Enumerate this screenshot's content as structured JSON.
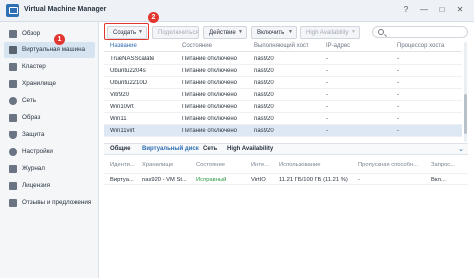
{
  "window": {
    "title": "Virtual Machine Manager",
    "buttons": [
      "?",
      "—",
      "□",
      "✕"
    ]
  },
  "sidebar": {
    "items": [
      {
        "label": "Обзор",
        "icon": "overview-icon",
        "color": "#5a6470"
      },
      {
        "label": "Виртуальная машина",
        "icon": "vm-icon",
        "color": "#5a6470",
        "active": true
      },
      {
        "label": "Кластер",
        "icon": "cluster-icon",
        "color": "#5a6470"
      },
      {
        "label": "Хранилище",
        "icon": "storage-icon",
        "color": "#5a6470"
      },
      {
        "label": "Сеть",
        "icon": "network-icon",
        "color": "#5a6470"
      },
      {
        "label": "Образ",
        "icon": "image-icon",
        "color": "#5a6470"
      },
      {
        "label": "Защита",
        "icon": "protection-icon",
        "color": "#5a6470"
      },
      {
        "label": "Настройки",
        "icon": "settings-icon",
        "color": "#5a6470"
      },
      {
        "label": "Журнал",
        "icon": "log-icon",
        "color": "#5a6470"
      },
      {
        "label": "Лицензия",
        "icon": "license-icon",
        "color": "#5a6470"
      },
      {
        "label": "Отзывы и предложения",
        "icon": "feedback-icon",
        "color": "#5a6470"
      }
    ]
  },
  "badges": {
    "one": "1",
    "two": "2"
  },
  "toolbar": {
    "create": "Создать",
    "connect": "Подключиться",
    "action": "Действие",
    "enable": "Включить",
    "high_availability": "High Availability",
    "search_icon": "search-icon"
  },
  "table": {
    "headers": [
      "Название",
      "Состояние",
      "Выполняющий хост",
      "IP-адрес",
      "Процессор хоста"
    ],
    "rows": [
      [
        "TrueNASScalate",
        "Питание отключено",
        "nas920",
        "-",
        "-"
      ],
      [
        "Ubuntu2204s",
        "Питание отключено",
        "nas920",
        "-",
        "-"
      ],
      [
        "Ubuntu2210D",
        "Питание отключено",
        "nas920",
        "-",
        "-"
      ],
      [
        "Vitr920",
        "Питание отключено",
        "nas920",
        "-",
        "-"
      ],
      [
        "Win10vrt",
        "Питание отключено",
        "nas920",
        "-",
        "-"
      ],
      [
        "Win11",
        "Питание отключено",
        "nas920",
        "-",
        "-"
      ],
      [
        "Win11virt",
        "Питание отключено",
        "nas920",
        "-",
        "-"
      ]
    ],
    "selected_row": 6
  },
  "details": {
    "tabs": [
      "Общие",
      "Виртуальный диск",
      "Сеть",
      "High Availability"
    ],
    "active_tab": 1,
    "headers": [
      "Иденти...",
      "Хранилище",
      "Состояние",
      "Инте...",
      "Использование",
      "Пропускная способн...",
      "Запрос..."
    ],
    "row": [
      "Виртуа...",
      "nas920 - VM St...",
      "Исправный",
      "VirtIO",
      "11.21 ГБ/100 ГБ (11.21 %)",
      "-",
      "Вкл..."
    ]
  },
  "colors": {
    "accent": "#2f6fb3",
    "highlight": "#e2372f",
    "healthy": "#2e9b48"
  }
}
